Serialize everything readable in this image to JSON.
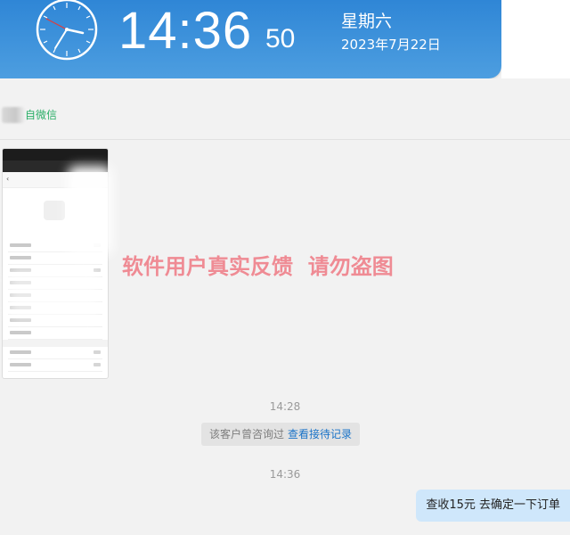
{
  "header": {
    "time": "14:36",
    "seconds": "50",
    "weekday": "星期六",
    "date": "2023年7月22日"
  },
  "contact": {
    "source_label": "自微信"
  },
  "watermark": {
    "text": "软件用户真实反馈  请勿盗图"
  },
  "messages": {
    "timestamp_1": "14:28",
    "system_note_text": "该客户曾咨询过",
    "system_note_link": "查看接待记录",
    "timestamp_2": "14:36",
    "outgoing_text": "查收15元  去确定一下订单"
  },
  "colors": {
    "header_gradient_top": "#2f86d6",
    "header_gradient_bottom": "#4d9ee0",
    "wechat_green": "#2aae67",
    "link_blue": "#1a73c8",
    "watermark_red": "#ef6f7a",
    "outgoing_bubble": "#cfe7fb",
    "background": "#f2f2f2"
  },
  "icons": {
    "clock": "analog-clock-icon"
  }
}
